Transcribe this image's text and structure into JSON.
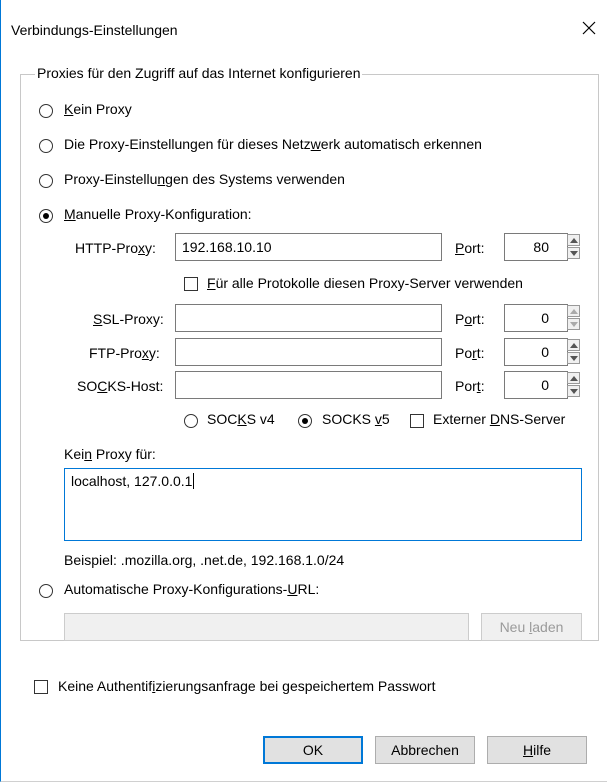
{
  "window": {
    "title": "Verbindungs-Einstellungen"
  },
  "group": {
    "legend": "Proxies für den Zugriff auf das Internet konfigurieren"
  },
  "options": {
    "none": {
      "pre": "",
      "key": "K",
      "post": "ein Proxy",
      "checked": false
    },
    "auto_detect": {
      "pre": "Die Proxy-Einstellungen für dieses Netz",
      "key": "w",
      "post": "erk automatisch erkennen",
      "checked": false
    },
    "system": {
      "pre": "Proxy-Einstellu",
      "key": "n",
      "post": "gen des Systems verwenden",
      "checked": false
    },
    "manual": {
      "pre": "",
      "key": "M",
      "post": "anuelle Proxy-Konfiguration:",
      "checked": true
    },
    "auto_url": {
      "pre": "Automatische Proxy-Konfigurations-",
      "key": "U",
      "post": "RL:",
      "checked": false
    }
  },
  "manual": {
    "http": {
      "label_pre": "HTTP-Pro",
      "label_key": "x",
      "label_post": "y:",
      "value": "192.168.10.10",
      "port_pre": "",
      "port_key": "P",
      "port_post": "ort:",
      "port": "80"
    },
    "all_protocols": {
      "pre": "",
      "key": "F",
      "post": "ür alle Protokolle diesen Proxy-Server verwenden",
      "checked": false
    },
    "ssl": {
      "label_pre": "",
      "label_key": "S",
      "label_post": "SL-Proxy:",
      "value": "",
      "port_pre": "P",
      "port_key": "o",
      "port_post": "rt:",
      "port": "0"
    },
    "ftp": {
      "label_pre": "FTP-Pro",
      "label_key": "x",
      "label_post": "y:",
      "value": "",
      "port_pre": "Po",
      "port_key": "r",
      "port_post": "t:",
      "port": "0"
    },
    "socks": {
      "label_pre": "SO",
      "label_key": "C",
      "label_post": "KS-Host:",
      "value": "",
      "port_pre": "Por",
      "port_key": "t",
      "port_post": ":",
      "port": "0"
    },
    "socks_v4": {
      "pre": "SOC",
      "key": "K",
      "post": "S v4",
      "checked": false
    },
    "socks_v5": {
      "pre": "SOCKS ",
      "key": "v",
      "post": "5",
      "checked": true
    },
    "remote_dns": {
      "pre": "Externer ",
      "key": "D",
      "post": "NS-Server",
      "checked": false
    }
  },
  "no_proxy": {
    "label_pre": "Kei",
    "label_key": "n",
    "label_post": " Proxy für:",
    "value": "localhost, 127.0.0.1",
    "example": "Beispiel: .mozilla.org, .net.de, 192.168.1.0/24"
  },
  "auto_url": {
    "value": "",
    "reload_pre": "Neu ",
    "reload_key": "l",
    "reload_post": "aden"
  },
  "auth": {
    "pre": "Keine Authentif",
    "key": "i",
    "post": "zierungsanfrage bei gespeichertem Passwort",
    "checked": false
  },
  "buttons": {
    "ok": "OK",
    "cancel": "Abbrechen",
    "help_pre": "",
    "help_key": "H",
    "help_post": "ilfe"
  }
}
